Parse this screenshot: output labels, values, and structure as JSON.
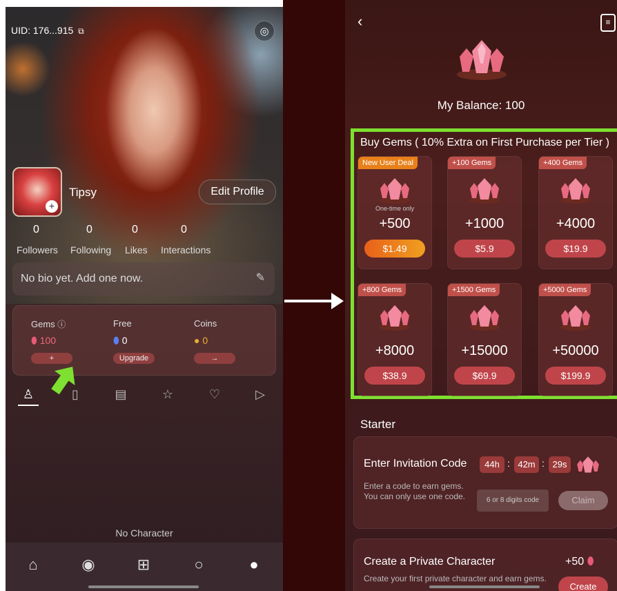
{
  "profile": {
    "uid": "UID: 176...915",
    "username": "Tipsy",
    "edit_profile": "Edit Profile",
    "stats": [
      {
        "value": "0",
        "label": "Followers"
      },
      {
        "value": "0",
        "label": "Following"
      },
      {
        "value": "0",
        "label": "Likes"
      },
      {
        "value": "0",
        "label": "Interactions"
      }
    ],
    "bio_placeholder": "No bio yet. Add one now.",
    "wallet": {
      "gems_label": "Gems",
      "gems_value": "100",
      "gems_button": "+",
      "free_label": "Free",
      "free_value": "0",
      "free_button": "Upgrade",
      "coins_label": "Coins",
      "coins_value": "0",
      "coins_button": "→"
    },
    "empty_text": "No Character"
  },
  "shop": {
    "balance": "My Balance: 100",
    "buy_title": "Buy Gems ( 10% Extra on First Purchase per Tier )",
    "one_time": "One-time only",
    "packs": [
      {
        "tag": "New User Deal",
        "amount": "+500",
        "price": "$1.49"
      },
      {
        "tag": "+100 Gems",
        "amount": "+1000",
        "price": "$5.9"
      },
      {
        "tag": "+400 Gems",
        "amount": "+4000",
        "price": "$19.9"
      },
      {
        "tag": "+800 Gems",
        "amount": "+8000",
        "price": "$38.9"
      },
      {
        "tag": "+1500 Gems",
        "amount": "+15000",
        "price": "$69.9"
      },
      {
        "tag": "+5000 Gems",
        "amount": "+50000",
        "price": "$199.9"
      }
    ],
    "starter": "Starter",
    "invitation": {
      "title": "Enter Invitation Code",
      "hours": "44h",
      "minutes": "42m",
      "seconds": "29s",
      "sep": ":",
      "description": "Enter a code to earn gems. You can only use one code.",
      "input_placeholder": "6 or 8 digits code",
      "claim": "Claim"
    },
    "private_character": {
      "title": "Create a Private Character",
      "reward": "+50",
      "description": "Create your first private character and earn gems.",
      "button": "Create"
    }
  },
  "colors": {
    "highlight": "#7ee030",
    "accent": "#c0454a",
    "gem": "#e85a78"
  }
}
